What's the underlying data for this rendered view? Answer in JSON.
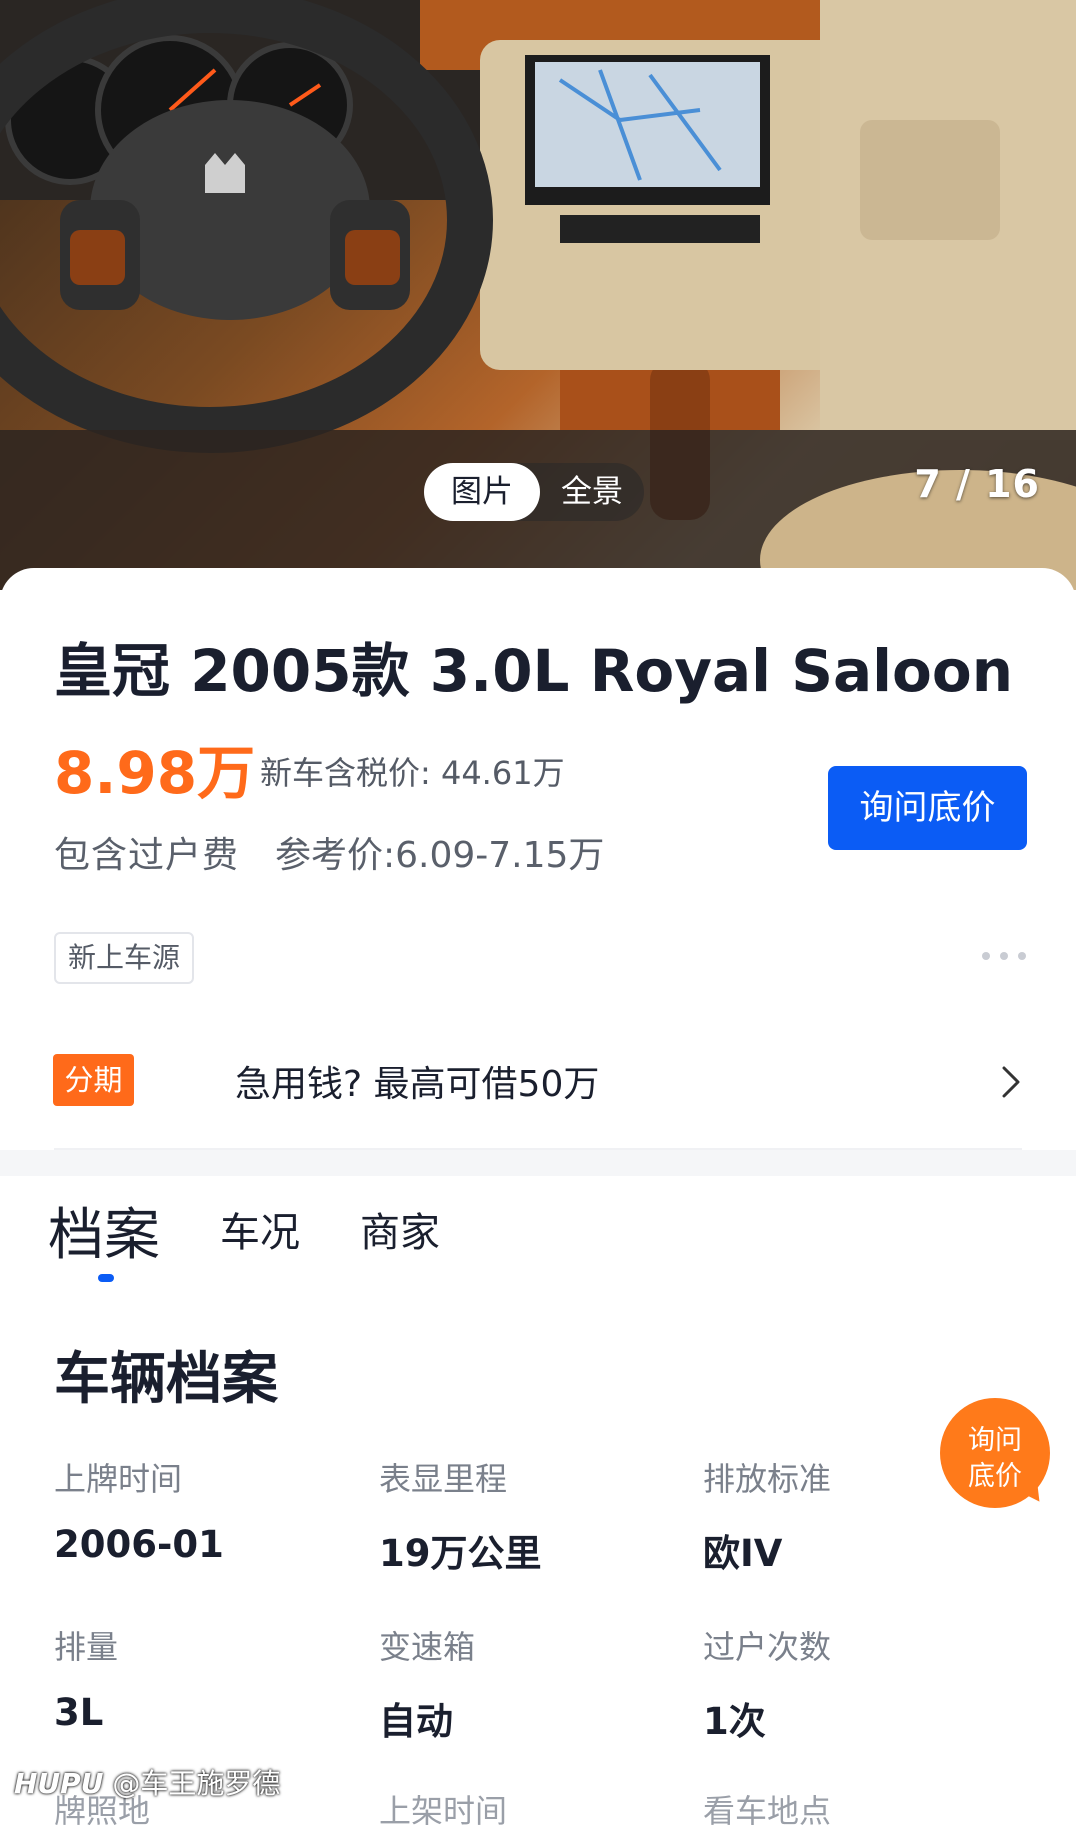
{
  "gallery": {
    "tabs": [
      {
        "label": "图片",
        "active": true
      },
      {
        "label": "全景",
        "active": false
      }
    ],
    "counter": "7 / 16"
  },
  "listing": {
    "title": "皇冠 2005款 3.0L Royal Saloon",
    "price": "8.98万",
    "new_price": "新车含税价: 44.61万",
    "fee_note": "包含过户费",
    "reference_price": "参考价:6.09-7.15万",
    "ask_button": "询问底价",
    "tag": "新上车源"
  },
  "loan": {
    "badge": "分期",
    "text": "急用钱?   最高可借50万"
  },
  "tabs": [
    {
      "label": "档案",
      "active": true
    },
    {
      "label": "车况",
      "active": false
    },
    {
      "label": "商家",
      "active": false
    }
  ],
  "archive": {
    "title": "车辆档案",
    "specs": [
      {
        "label": "上牌时间",
        "value": "2006-01"
      },
      {
        "label": "表显里程",
        "value": "19万公里"
      },
      {
        "label": "排放标准",
        "value": "欧IV"
      },
      {
        "label": "排量",
        "value": "3L"
      },
      {
        "label": "变速箱",
        "value": "自动"
      },
      {
        "label": "过户次数",
        "value": "1次"
      }
    ],
    "partial_labels": [
      "牌照地",
      "上架时间",
      "看车地点"
    ]
  },
  "floating_ask": {
    "line1": "询问",
    "line2": "底价"
  },
  "watermark": {
    "brand": "HUPU",
    "handle": "@车王施罗德"
  },
  "colors": {
    "accent_blue": "#0b5cf5",
    "price_orange": "#ff6a1a",
    "text_dark": "#1a1f2e"
  }
}
